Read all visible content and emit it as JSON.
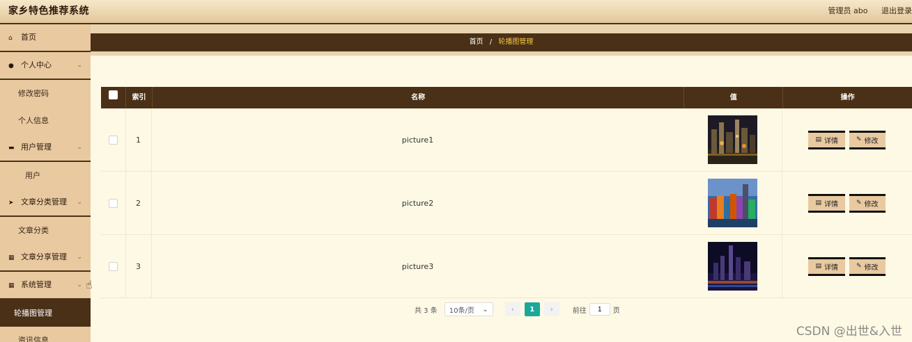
{
  "header": {
    "title": "家乡特色推荐系统",
    "user": "管理员 abo",
    "logout": "退出登录"
  },
  "sidebar": {
    "items": [
      {
        "type": "menu",
        "label": "首页",
        "icon": "home-icon",
        "glyph": "⌂",
        "chevron": false
      },
      {
        "type": "menu",
        "label": "个人中心",
        "icon": "user-icon",
        "glyph": "●",
        "chevron": true
      },
      {
        "type": "sub",
        "label": "修改密码"
      },
      {
        "type": "sub",
        "label": "个人信息"
      },
      {
        "type": "menu",
        "label": "用户管理",
        "icon": "id-card-icon",
        "glyph": "▬",
        "chevron": true
      },
      {
        "type": "sub",
        "label": "用户",
        "indent": true
      },
      {
        "type": "menu",
        "label": "文章分类管理",
        "icon": "paper-plane-icon",
        "glyph": "➤",
        "chevron": true
      },
      {
        "type": "sub",
        "label": "文章分类"
      },
      {
        "type": "menu",
        "label": "文章分享管理",
        "icon": "grid-icon",
        "glyph": "▦",
        "chevron": true
      },
      {
        "type": "menu",
        "label": "系统管理",
        "icon": "grid-icon",
        "glyph": "▦",
        "chevron": true
      },
      {
        "type": "sub",
        "label": "轮播图管理",
        "active": true
      },
      {
        "type": "sub",
        "label": "资讯信息"
      }
    ]
  },
  "breadcrumb": {
    "home": "首页",
    "separator": "/",
    "current": "轮播图管理"
  },
  "table": {
    "headers": {
      "index": "索引",
      "name": "名称",
      "value": "值",
      "ops": "操作"
    },
    "rows": [
      {
        "index": "1",
        "name": "picture1",
        "image": "city-night-thumbnail"
      },
      {
        "index": "2",
        "name": "picture2",
        "image": "colorful-buildings-thumbnail"
      },
      {
        "index": "3",
        "name": "picture3",
        "image": "skyline-night-thumbnail"
      }
    ],
    "detail_label": "详情",
    "edit_label": "修改"
  },
  "pagination": {
    "total": "共 3 条",
    "page_size": "10条/页",
    "prev": "‹",
    "current": "1",
    "next": "›",
    "goto_prefix": "前往",
    "goto_value": "1",
    "goto_suffix": "页"
  },
  "watermark": "CSDN @出世&入世",
  "colors": {
    "header_bg": "#e3c79b",
    "dark_brown": "#4a3016",
    "sidebar_bg": "#e8c9a0",
    "content_bg": "#fdf9e4",
    "active_page": "#1aa89a"
  }
}
